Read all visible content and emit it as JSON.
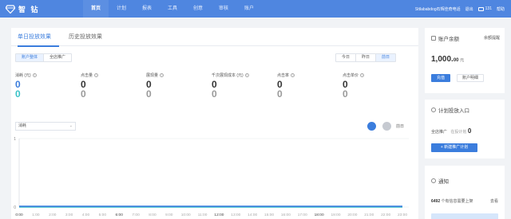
{
  "header": {
    "brand": "智 钻",
    "nav": [
      "首页",
      "计划",
      "报表",
      "工具",
      "创意",
      "审核",
      "账户"
    ],
    "user": "Sttlababdog石辉佳奇电话",
    "logout": "退出",
    "mail_count": "131",
    "help": "帮助"
  },
  "main": {
    "tabs": [
      "单日投放效果",
      "历史投放效果"
    ],
    "scope": [
      "账户整体",
      "全店推广"
    ],
    "period": [
      "今日",
      "昨日",
      "前日"
    ],
    "metrics": [
      {
        "label": "消耗 (元)",
        "today": "0",
        "prev": "0"
      },
      {
        "label": "点击量",
        "today": "0",
        "prev": "0"
      },
      {
        "label": "展现量",
        "today": "0",
        "prev": "0"
      },
      {
        "label": "千次展现成本 (元)",
        "today": "0",
        "prev": "0"
      },
      {
        "label": "点击率",
        "today": "0",
        "prev": "0"
      },
      {
        "label": "点击单价",
        "today": "0",
        "prev": "0"
      }
    ],
    "metric_select": "消耗",
    "toggle_label": "前日"
  },
  "chart_data": {
    "type": "line",
    "x": [
      "0:00",
      "1:00",
      "2:00",
      "3:00",
      "4:00",
      "5:00",
      "6:00",
      "7:00",
      "8:00",
      "9:00",
      "10:00",
      "11:00",
      "12:00",
      "13:00",
      "14:00",
      "15:00",
      "16:00",
      "17:00",
      "18:00",
      "19:00",
      "20:00",
      "21:00",
      "22:00",
      "23:00"
    ],
    "y_ticks": [
      "1",
      "0"
    ],
    "ylim": [
      0,
      1
    ],
    "series": [
      {
        "values": [
          0,
          0,
          0,
          0,
          0,
          0,
          0,
          0,
          0,
          0,
          0,
          0,
          0,
          0,
          0,
          0,
          0,
          0,
          0,
          0,
          0,
          0,
          0,
          0
        ],
        "color": "#3ac2c8"
      },
      {
        "values": [
          0,
          0,
          0,
          0,
          0,
          0,
          0,
          0,
          0,
          0,
          0,
          0,
          0,
          0,
          0,
          0,
          0,
          0,
          0,
          0,
          0,
          0,
          0,
          0
        ],
        "color": "#3b7ddd"
      }
    ]
  },
  "side": {
    "balance_title": "账户余额",
    "balance_link": "余额提醒",
    "balance": "1,000.",
    "balance_cents": "00",
    "balance_unit": "元",
    "recharge": "充值",
    "detail": "账户明细",
    "plan_title": "计划投放入口",
    "plan_label": "全店推广",
    "plan_sub": "在投计划",
    "plan_count": "0",
    "new_plan": "+ 新建推广计划",
    "notice_title": "通知",
    "notice_count": "6492",
    "notice_text": "个有信息需要上架",
    "notice_link": "去看"
  },
  "colors": {
    "accent": "#3b7ddd",
    "teal": "#3ac2c8",
    "topbar": "#4f86e0"
  }
}
